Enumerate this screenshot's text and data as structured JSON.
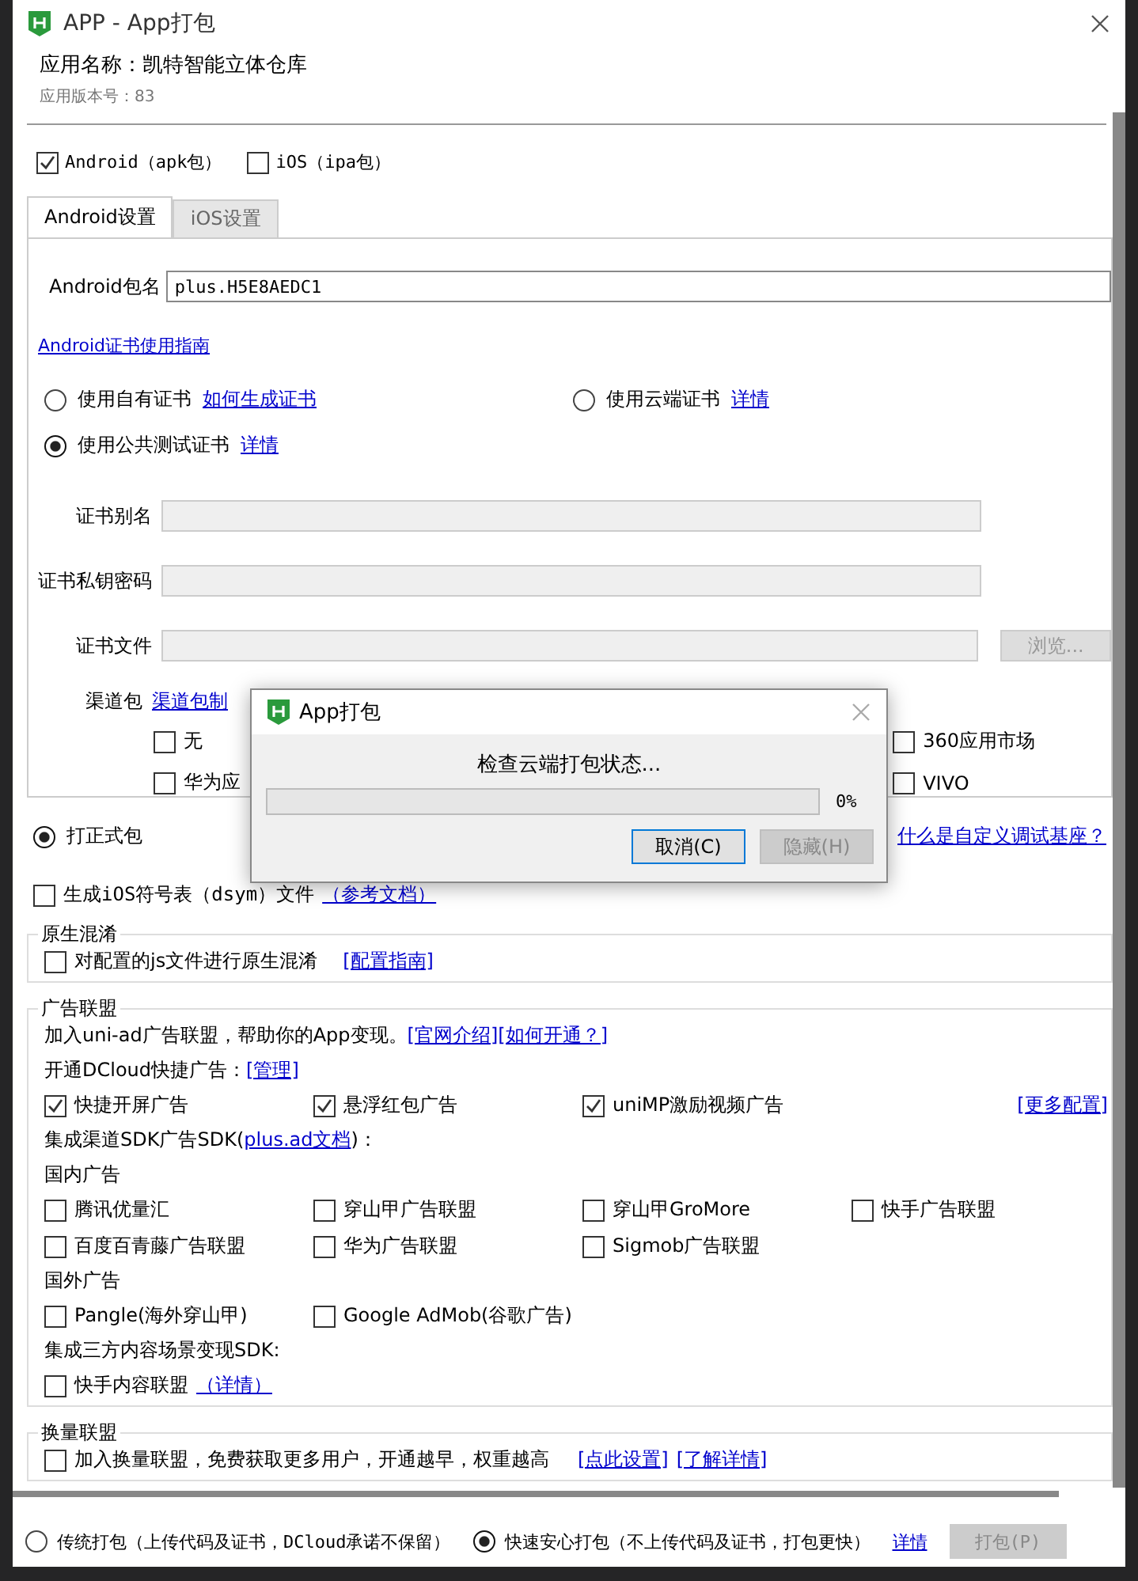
{
  "window": {
    "title": "APP - App打包"
  },
  "app_info": {
    "name": "应用名称：凯特智能立体仓库",
    "version": "应用版本号：83"
  },
  "platforms": [
    {
      "label": "Android（apk包）",
      "checked": true
    },
    {
      "label": "iOS（ipa包）",
      "checked": false
    }
  ],
  "tabs": [
    {
      "label": "Android设置",
      "selected": true
    },
    {
      "label": "iOS设置",
      "selected": false
    }
  ],
  "package_name": {
    "label": "Android包名",
    "value": "plus.H5E8AEDC1"
  },
  "cert_guide_link": "Android证书使用指南",
  "cert_options": [
    {
      "label": "使用自有证书",
      "link": "如何生成证书",
      "selected": false
    },
    {
      "label": "使用云端证书",
      "link": "详情",
      "selected": false
    },
    {
      "label": "使用公共测试证书",
      "link": "详情",
      "selected": true
    }
  ],
  "cert_fields": [
    {
      "label": "证书别名",
      "disabled": true
    },
    {
      "label": "证书私钥密码",
      "disabled": true
    },
    {
      "label": "证书文件",
      "disabled": true,
      "button": "浏览..."
    }
  ],
  "channel": {
    "label": "渠道包",
    "link": "渠道包制",
    "options": [
      {
        "label": "无",
        "checked": false
      },
      {
        "label": "360应用市场",
        "checked": false
      },
      {
        "label": "华为应",
        "checked": false
      },
      {
        "label": "VIVO",
        "checked": false
      }
    ]
  },
  "build_type": {
    "label": "打正式包",
    "selected": true,
    "link": "什么是自定义调试基座？"
  },
  "ios_symbols": {
    "label": "生成iOS符号表（dsym）文件",
    "link": "（参考文档）",
    "checked": false
  },
  "native_obfuscation": {
    "title": "原生混淆",
    "label": "对配置的js文件进行原生混淆",
    "link": "[配置指南]",
    "checked": false
  },
  "ad_alliance": {
    "title": "广告联盟",
    "intro": "加入uni-ad广告联盟，帮助你的App变现。",
    "intro_links": [
      "[官网介绍]",
      "[如何开通？]"
    ],
    "quick_label": "开通DCloud快捷广告：",
    "quick_link": "[管理]",
    "quick_ads": [
      {
        "label": "快捷开屏广告",
        "checked": true
      },
      {
        "label": "悬浮红包广告",
        "checked": true
      },
      {
        "label": "uniMP激励视频广告",
        "checked": true
      }
    ],
    "more_link": "[更多配置]",
    "sdk_label": "集成渠道SDK广告SDK(",
    "sdk_link": "plus.ad文档",
    "sdk_suffix": ")：",
    "domestic_title": "国内广告",
    "domestic": [
      {
        "label": "腾讯优量汇",
        "checked": false
      },
      {
        "label": "穿山甲广告联盟",
        "checked": false
      },
      {
        "label": "穿山甲GroMore",
        "checked": false
      },
      {
        "label": "快手广告联盟",
        "checked": false
      },
      {
        "label": "百度百青藤广告联盟",
        "checked": false
      },
      {
        "label": "华为广告联盟",
        "checked": false
      },
      {
        "label": "Sigmob广告联盟",
        "checked": false
      }
    ],
    "foreign_title": "国外广告",
    "foreign": [
      {
        "label": "Pangle(海外穿山甲)",
        "checked": false
      },
      {
        "label": "Google AdMob(谷歌广告)",
        "checked": false
      }
    ],
    "content_title": "集成三方内容场景变现SDK:",
    "content": [
      {
        "label": "快手内容联盟",
        "link": "（详情）",
        "checked": false
      }
    ]
  },
  "exchange": {
    "title": "换量联盟",
    "label": "加入换量联盟，免费获取更多用户，开通越早，权重越高",
    "links": [
      "[点此设置]",
      "[了解详情]"
    ],
    "checked": false
  },
  "footer": {
    "modes": [
      {
        "label": "传统打包（上传代码及证书，DCloud承诺不保留）",
        "selected": false
      },
      {
        "label": "快速安心打包（不上传代码及证书，打包更快）",
        "selected": true
      }
    ],
    "link": "详情",
    "button": {
      "label": "打包(P)",
      "disabled": true
    }
  },
  "progress_dialog": {
    "title": "App打包",
    "message": "检查云端打包状态...",
    "level": 0,
    "reading": "0%",
    "buttons": [
      {
        "label": "取消(C)",
        "disabled": false
      },
      {
        "label": "隐藏(H)",
        "disabled": true
      }
    ]
  }
}
